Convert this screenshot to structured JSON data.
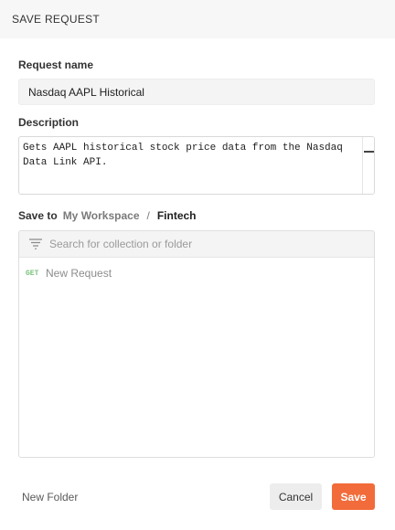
{
  "dialog": {
    "title": "SAVE REQUEST"
  },
  "request_name": {
    "label": "Request name",
    "value": "Nasdaq AAPL Historical"
  },
  "description": {
    "label": "Description",
    "value": "Gets AAPL historical stock price data from the Nasdaq Data Link API."
  },
  "save_to": {
    "label": "Save to",
    "breadcrumb": [
      "My Workspace",
      "Fintech"
    ],
    "separator": "/"
  },
  "collection_browser": {
    "search_placeholder": "Search for collection or folder",
    "search_value": "",
    "items": [
      {
        "method": "GET",
        "name": "New Request"
      }
    ]
  },
  "footer": {
    "new_folder_label": "New Folder",
    "cancel_label": "Cancel",
    "save_label": "Save"
  },
  "colors": {
    "accent": "#f26b3a",
    "method_get": "#7ac27a"
  },
  "icons": {
    "filter": "filter-lines-icon"
  }
}
